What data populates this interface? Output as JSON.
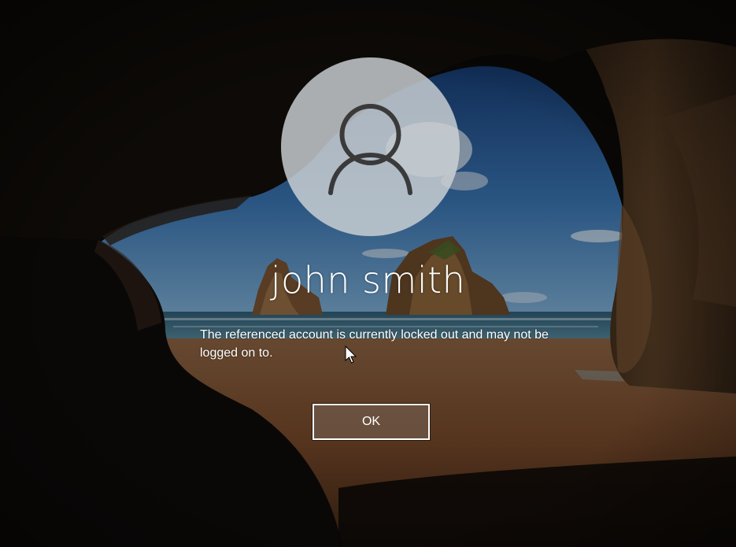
{
  "lock_screen": {
    "user_name": "john smith",
    "avatar_icon": "user-silhouette-icon",
    "message": "The referenced account is currently locked out and may not be logged on to.",
    "ok_label": "OK"
  },
  "colors": {
    "sky_top": "#1a4a86",
    "sky_bottom": "#5f97c9",
    "sea": "#3b6f8a",
    "sand": "#8a5a36",
    "cave_dark": "#0b0a09",
    "avatar_fill": "#ced3d6",
    "text": "#ffffff"
  }
}
